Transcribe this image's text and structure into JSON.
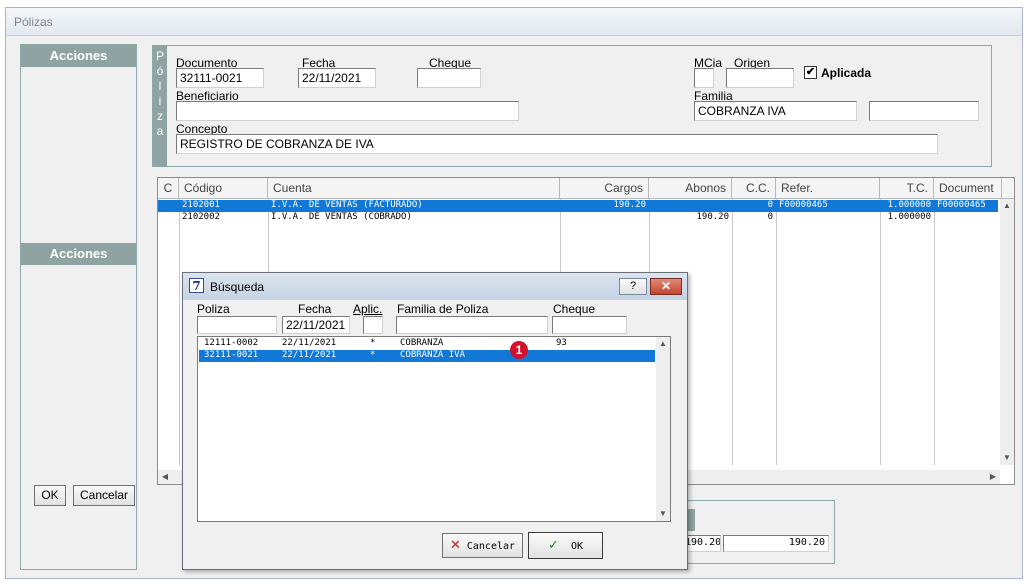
{
  "window": {
    "title": "Pólizas"
  },
  "acciones": {
    "top_label": "Acciones",
    "bottom_label": "Acciones",
    "ok_label": "OK",
    "cancel_label": "Cancelar"
  },
  "poliza": {
    "vertical_tab": [
      "P",
      "ó",
      "l",
      "i",
      "z",
      "a"
    ],
    "documento_label": "Documento",
    "documento_value": "32111-0021",
    "fecha_label": "Fecha",
    "fecha_value": "22/11/2021",
    "cheque_label": "Cheque",
    "cheque_value": "",
    "mcia_label": "MCia",
    "origen_label": "Origen",
    "aplicada_label": "Aplicada",
    "aplicada_checked": true,
    "beneficiario_label": "Beneficiario",
    "beneficiario_value": "",
    "familia_label": "Familia",
    "familia_value": "COBRANZA IVA",
    "familia_extra": "",
    "concepto_label": "Concepto",
    "concepto_value": "REGISTRO DE COBRANZA DE IVA"
  },
  "grid": {
    "headers": [
      "C",
      "Código",
      "Cuenta",
      "Cargos",
      "Abonos",
      "C.C.",
      "Refer.",
      "T.C.",
      "Document"
    ],
    "rows": [
      {
        "codigo": "2102001",
        "cuenta": "I.V.A. DE VENTAS (FACTURADO)",
        "cargos": "190.20",
        "abonos": "",
        "cc": "0",
        "refer": "F00000465",
        "tc": "1.000000",
        "doc": "F00000465",
        "selected": true
      },
      {
        "codigo": "2102002",
        "cuenta": "I.V.A. DE VENTAS (COBRADO)",
        "cargos": "",
        "abonos": "190.20",
        "cc": "0",
        "refer": "",
        "tc": "1.000000",
        "doc": "",
        "selected": false
      }
    ]
  },
  "totals": {
    "cargos": "190.20",
    "abonos": "190.20"
  },
  "dialog": {
    "title": "Búsqueda",
    "help_label": "?",
    "headers": {
      "poliza": "Poliza",
      "fecha": "Fecha",
      "aplic": "Aplic.",
      "familia": "Familia de Poliza",
      "cheque": "Cheque"
    },
    "filters": {
      "poliza": "",
      "fecha": "22/11/2021",
      "aplic": "",
      "familia": "",
      "cheque": ""
    },
    "rows": [
      {
        "poliza": "12111-0002",
        "fecha": "22/11/2021",
        "aplic": "*",
        "familia": "COBRANZA",
        "cheque": "93",
        "selected": false
      },
      {
        "poliza": "32111-0021",
        "fecha": "22/11/2021",
        "aplic": "*",
        "familia": "COBRANZA IVA",
        "cheque": "",
        "selected": true
      }
    ],
    "badge": "1",
    "cancel_label": "Cancelar",
    "ok_label": "OK"
  }
}
